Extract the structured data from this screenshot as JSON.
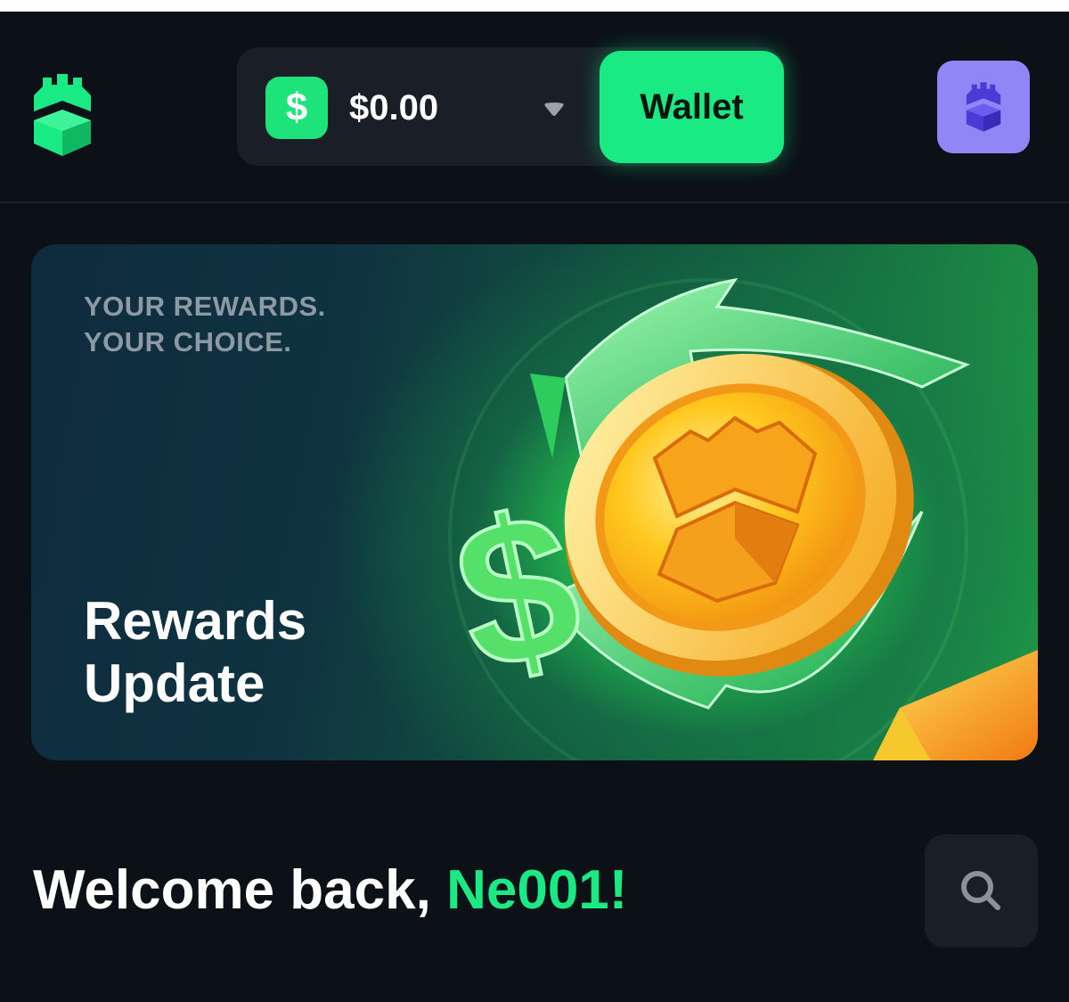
{
  "header": {
    "balance": {
      "currency_symbol": "$",
      "amount": "$0.00"
    },
    "wallet_label": "Wallet"
  },
  "banner": {
    "tagline_line1": "YOUR REWARDS.",
    "tagline_line2": "YOUR CHOICE.",
    "title_line1": "Rewards",
    "title_line2": "Update",
    "art_symbol": "$"
  },
  "welcome": {
    "greeting": "Welcome back,",
    "username": "Ne001!"
  },
  "icons": {
    "logo": "castle-tower-logo-icon",
    "dropdown": "chevron-down-icon",
    "profile": "castle-avatar-icon",
    "search": "search-icon"
  },
  "colors": {
    "accent": "#19ea84",
    "background": "#0c1117",
    "panel": "#1a1f27",
    "avatar": "#8f87f5"
  }
}
